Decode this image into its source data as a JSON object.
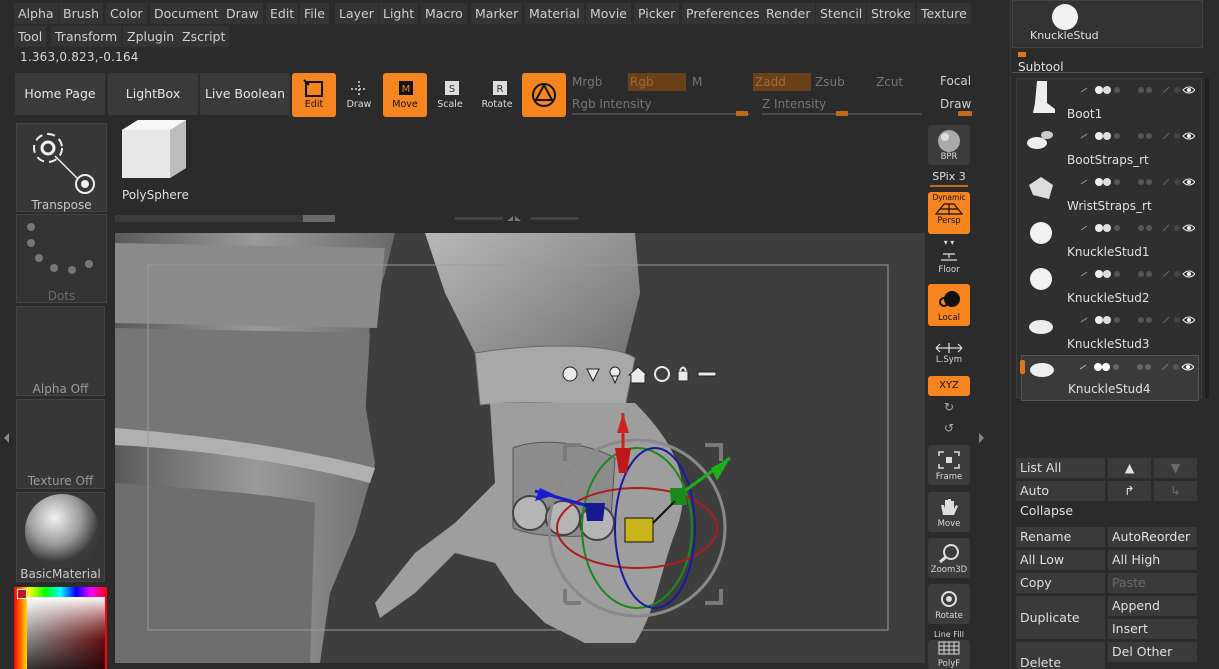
{
  "menubar": {
    "row1": [
      "Alpha",
      "Brush",
      "Color",
      "Document",
      "Draw",
      "Edit",
      "File",
      "Layer",
      "Light",
      "Macro",
      "Marker",
      "Material",
      "Movie",
      "Picker",
      "Preferences",
      "Render",
      "Stencil",
      "Stroke",
      "Texture"
    ],
    "row2": [
      "Tool",
      "Transform",
      "Zplugin",
      "Zscript"
    ]
  },
  "coords": "1.363,0.823,-0.164",
  "top_buttons": {
    "home": "Home Page",
    "lightbox": "LightBox",
    "live_boolean": "Live Boolean"
  },
  "tools": {
    "edit": "Edit",
    "draw": "Draw",
    "move": "Move",
    "scale": "Scale",
    "rotate": "Rotate"
  },
  "sliders": {
    "mrgb": "Mrgb",
    "rgb": "Rgb",
    "m": "M",
    "zadd": "Zadd",
    "zsub": "Zsub",
    "zcut": "Zcut",
    "rgb_intensity": "Rgb Intensity",
    "z_intensity": "Z Intensity",
    "focal": "Focal S",
    "draw": "Draw"
  },
  "left_panel": {
    "transpose": "Transpose",
    "dots": "Dots",
    "alpha": "Alpha Off",
    "texture": "Texture Off",
    "material": "BasicMaterial"
  },
  "tool_thumb": "PolySphere",
  "right_toolbar": {
    "bpr": "BPR",
    "spix": "SPix 3",
    "dynamic": "Dynamic",
    "persp": "Persp",
    "floor": "Floor",
    "local": "Local",
    "lsym": "L.Sym",
    "xyz": "XYZ",
    "frame": "Frame",
    "move": "Move",
    "zoom3d": "Zoom3D",
    "rotate": "Rotate",
    "linefill": "Line Fill",
    "polyf": "PolyF"
  },
  "current_tool": "KnuckleStud",
  "subtool_header": "Subtool",
  "subtools": [
    "Boot1",
    "BootStraps_rt",
    "WristStraps_rt",
    "KnuckleStud1",
    "KnuckleStud2",
    "KnuckleStud3",
    "KnuckleStud4"
  ],
  "subtool_controls": {
    "list_all": "List All",
    "auto_collapse": "Auto Collapse",
    "rename": "Rename",
    "auto_reorder": "AutoReorder",
    "all_low": "All Low",
    "all_high": "All High",
    "copy": "Copy",
    "paste": "Paste",
    "duplicate": "Duplicate",
    "append": "Append",
    "insert": "Insert",
    "delete": "Delete",
    "del_other": "Del Other"
  },
  "colors": {
    "accent": "#f6851f",
    "panel": "#2b2b2b",
    "button": "#3a3a3a"
  }
}
